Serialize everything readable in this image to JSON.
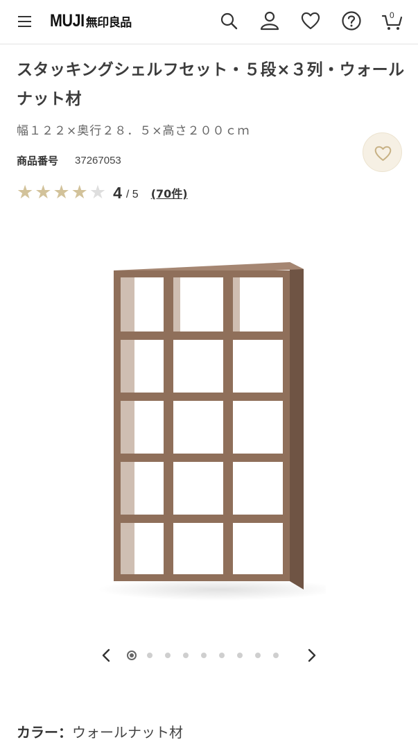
{
  "header": {
    "logo_en": "MUJI",
    "logo_jp": "無印良品",
    "cart_count": "0"
  },
  "product": {
    "title": "スタッキングシェルフセット・５段×３列・ウォールナット材",
    "dimensions": "幅１２２×奥行２８．５×高さ２００ｃｍ",
    "product_no_label": "商品番号",
    "product_no": "37267053"
  },
  "rating": {
    "value": 4,
    "max": 5,
    "score_text": "4",
    "max_text": "/ 5",
    "reviews_text": "(70件)"
  },
  "carousel": {
    "total_slides": 9,
    "active_index": 0
  },
  "color": {
    "label": "カラー：",
    "value": "ウォールナット材"
  },
  "colors": {
    "accent_beige": "#f6f0e4",
    "star_gold": "#d2c29a",
    "wood": "#8f6f5a"
  },
  "icons": [
    "menu-icon",
    "search-icon",
    "account-icon",
    "heart-icon",
    "help-icon",
    "cart-icon",
    "chevron-left-icon",
    "chevron-right-icon"
  ]
}
